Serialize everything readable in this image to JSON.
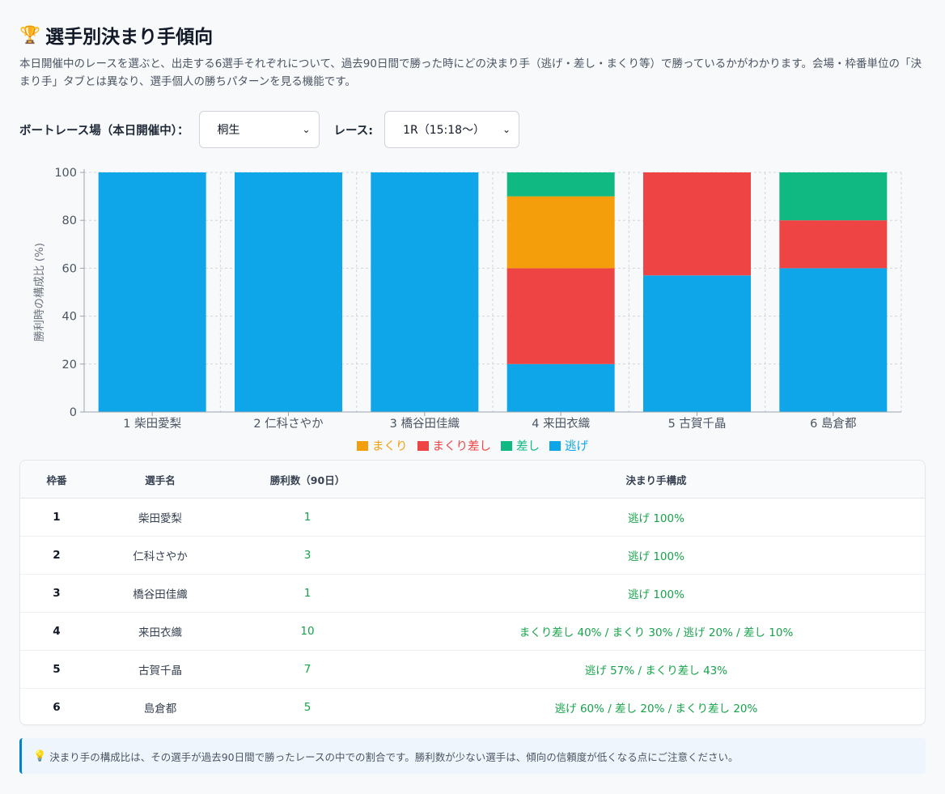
{
  "header": {
    "title": "選手別決まり手傾向",
    "description": "本日開催中のレースを選ぶと、出走する6選手それぞれについて、過去90日間で勝った時にどの決まり手（逃げ・差し・まくり等）で勝っているかがわかります。会場・枠番単位の「決まり手」タブとは異なり、選手個人の勝ちパターンを見る機能です。"
  },
  "controls": {
    "venue_label": "ボートレース場（本日開催中）：",
    "venue_value": "桐生",
    "race_label": "レース:",
    "race_value": "1R（15:18〜）"
  },
  "chart_data": {
    "type": "bar",
    "stacked": true,
    "ylabel": "勝利時の構成比 (%)",
    "xlabel": "",
    "ylim": [
      0,
      100
    ],
    "yticks": [
      0,
      20,
      40,
      60,
      80,
      100
    ],
    "grid": true,
    "legend_position": "bottom",
    "categories": [
      "1 柴田愛梨",
      "2 仁科さやか",
      "3 橋谷田佳織",
      "4 来田衣織",
      "5 古賀千晶",
      "6 島倉都"
    ],
    "series": [
      {
        "name": "逃げ",
        "color": "#0ea5e9",
        "values": [
          100,
          100,
          100,
          20,
          57,
          60
        ]
      },
      {
        "name": "まくり差し",
        "color": "#ef4444",
        "values": [
          0,
          0,
          0,
          40,
          43,
          20
        ]
      },
      {
        "name": "まくり",
        "color": "#f59e0b",
        "values": [
          0,
          0,
          0,
          30,
          0,
          0
        ]
      },
      {
        "name": "差し",
        "color": "#10b981",
        "values": [
          0,
          0,
          0,
          10,
          0,
          20
        ]
      }
    ],
    "legend_order": [
      "まくり",
      "まくり差し",
      "差し",
      "逃げ"
    ]
  },
  "table": {
    "headers": [
      "枠番",
      "選手名",
      "勝利数（90日）",
      "決まり手構成"
    ],
    "rows": [
      {
        "frame": "1",
        "name": "柴田愛梨",
        "wins": "1",
        "composition": "逃げ 100%"
      },
      {
        "frame": "2",
        "name": "仁科さやか",
        "wins": "3",
        "composition": "逃げ 100%"
      },
      {
        "frame": "3",
        "name": "橋谷田佳織",
        "wins": "1",
        "composition": "逃げ 100%"
      },
      {
        "frame": "4",
        "name": "来田衣織",
        "wins": "10",
        "composition": "まくり差し 40% / まくり 30% / 逃げ 20% / 差し 10%"
      },
      {
        "frame": "5",
        "name": "古賀千晶",
        "wins": "7",
        "composition": "逃げ 57% / まくり差し 43%"
      },
      {
        "frame": "6",
        "name": "島倉都",
        "wins": "5",
        "composition": "逃げ 60% / 差し 20% / まくり差し 20%"
      }
    ]
  },
  "note": "決まり手の構成比は、その選手が過去90日間で勝ったレースの中での割合です。勝利数が少ない選手は、傾向の信頼度が低くなる点にご注意ください。",
  "icons": {
    "title": "trophy-icon",
    "note": "lightbulb-icon"
  }
}
